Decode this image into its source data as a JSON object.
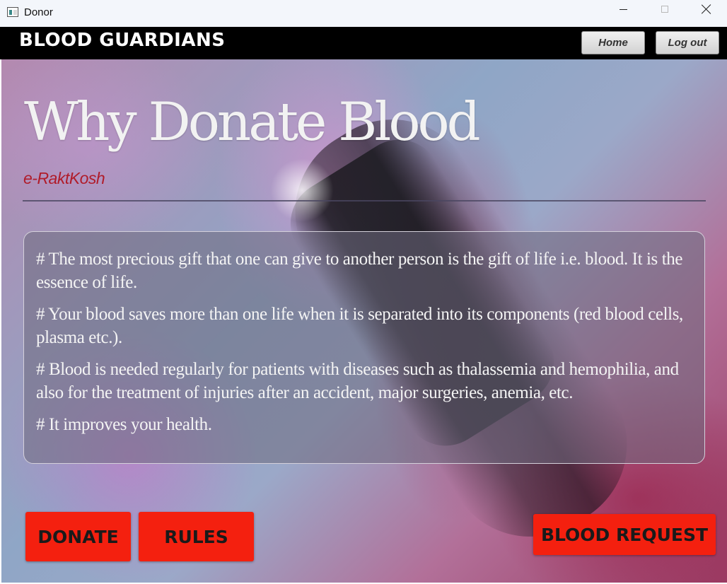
{
  "window": {
    "title": "Donor",
    "icon": "app-window-icon",
    "controls": [
      "minimize-icon",
      "maximize-icon",
      "close-icon"
    ]
  },
  "header": {
    "brand": "BLOOD GUARDIANS",
    "home_label": "Home",
    "logout_label": "Log out"
  },
  "main": {
    "heading": "Why Donate Blood",
    "subtitle": "e-RaktKosh",
    "points": [
      "# The most precious gift that one can give to another person is the gift of life i.e. blood. It is the essence of life.",
      "# Your blood saves more than one life when it is separated into its components (red blood cells, plasma etc.).",
      "# Blood is needed regularly for patients with diseases such as thalassemia and hemophilia, and also for the treatment of injuries after an accident, major surgeries, anemia, etc.",
      "# It improves your health."
    ]
  },
  "actions": {
    "donate_label": "DONATE",
    "rules_label": "RULES",
    "request_label": "BLOOD REQUEST"
  },
  "colors": {
    "header_bg": "#000000",
    "action_button": "#f4200f",
    "subtitle": "#b01c2a"
  }
}
